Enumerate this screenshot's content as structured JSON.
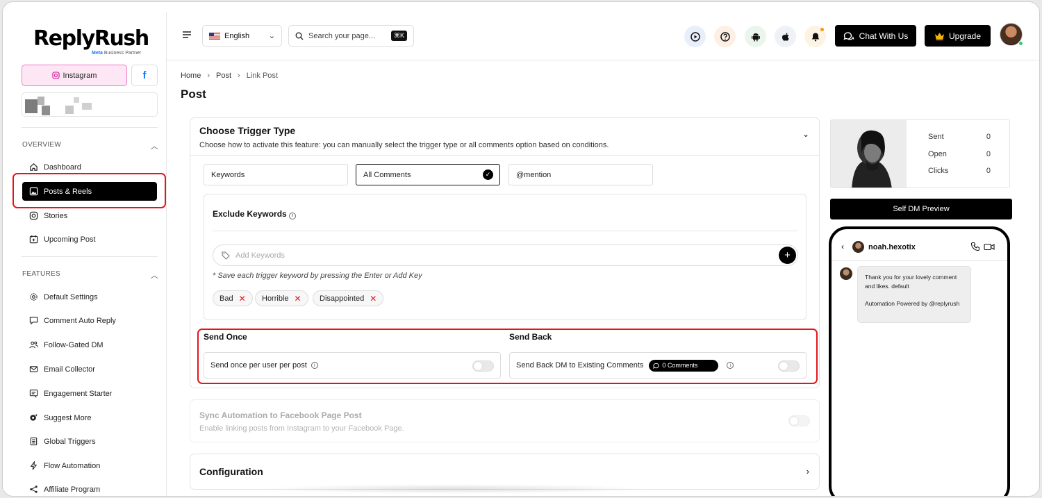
{
  "brand": {
    "name": "ReplyRush",
    "partner_prefix": "Meta",
    "partner_suffix": "Business Partner"
  },
  "platforms": {
    "instagram_label": "Instagram",
    "facebook_glyph": "f"
  },
  "sidebar": {
    "overview_label": "OVERVIEW",
    "overview_items": [
      {
        "label": "Dashboard",
        "icon": "home-icon"
      },
      {
        "label": "Posts & Reels",
        "icon": "image-icon",
        "active": true
      },
      {
        "label": "Stories",
        "icon": "instagram-icon"
      },
      {
        "label": "Upcoming Post",
        "icon": "calendar-icon"
      }
    ],
    "features_label": "FEATURES",
    "feature_items": [
      {
        "label": "Default Settings",
        "icon": "gear-icon"
      },
      {
        "label": "Comment Auto Reply",
        "icon": "comment-icon"
      },
      {
        "label": "Follow-Gated DM",
        "icon": "users-icon"
      },
      {
        "label": "Email Collector",
        "icon": "mail-icon"
      },
      {
        "label": "Engagement Starter",
        "icon": "engage-icon"
      },
      {
        "label": "Suggest More",
        "icon": "gear-star-icon"
      },
      {
        "label": "Global Triggers",
        "icon": "book-icon"
      },
      {
        "label": "Flow Automation",
        "icon": "bolt-icon"
      },
      {
        "label": "Affiliate Program",
        "icon": "share-icon"
      }
    ]
  },
  "header": {
    "language": "English",
    "search_placeholder": "Search your page...",
    "search_shortcut": "⌘K",
    "chat_label": "Chat With Us",
    "upgrade_label": "Upgrade",
    "icons": [
      "play-icon",
      "help-icon",
      "android-icon",
      "apple-icon",
      "bell-icon"
    ]
  },
  "breadcrumb": [
    "Home",
    "Post",
    "Link Post"
  ],
  "page_title": "Post",
  "trigger": {
    "title": "Choose Trigger Type",
    "description": "Choose how to activate this feature: you can manually select the trigger type or all comments option based on conditions.",
    "options": [
      "Keywords",
      "All Comments",
      "@mention"
    ],
    "selected": "All Comments"
  },
  "exclude": {
    "title": "Exclude Keywords",
    "placeholder": "Add Keywords",
    "note": "* Save each trigger keyword by pressing the Enter or Add Key",
    "tags": [
      "Bad",
      "Horrible",
      "Disappointed"
    ]
  },
  "send_once": {
    "title": "Send Once",
    "label": "Send once per user per post",
    "enabled": false
  },
  "send_back": {
    "title": "Send Back",
    "label": "Send Back DM to Existing Comments",
    "badge": "0 Comments",
    "enabled": false
  },
  "sync": {
    "title": "Sync Automation to Facebook Page Post",
    "description": "Enable linking posts from Instagram to your Facebook Page.",
    "enabled": false
  },
  "configuration": {
    "title": "Configuration"
  },
  "stats": {
    "sent_label": "Sent",
    "sent": "0",
    "open_label": "Open",
    "open": "0",
    "clicks_label": "Clicks",
    "clicks": "0"
  },
  "preview": {
    "button_label": "Self DM Preview",
    "username": "noah.hexotix",
    "message": "Thank you for your lovely comment and likes. default\n\nAutomation Powered by @replyrush"
  },
  "colors": {
    "highlight": "#e4141c",
    "instagram_bg": "#fde7f4",
    "facebook": "#1877f2"
  }
}
